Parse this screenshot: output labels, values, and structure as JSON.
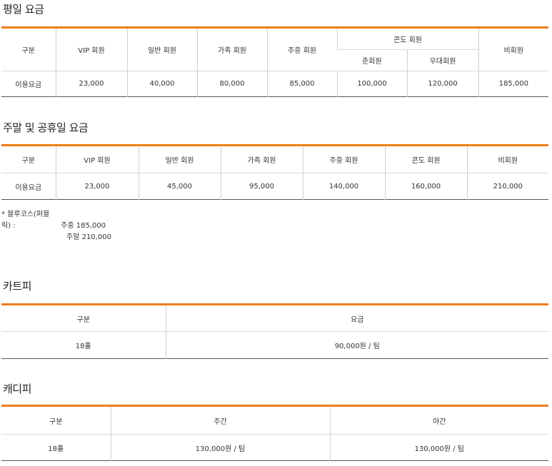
{
  "weekday": {
    "title": "평일 요금",
    "headers": {
      "category": "구분",
      "vip": "VIP 회원",
      "general": "일반 회원",
      "family": "가족 회원",
      "weekday_member": "주중 회원",
      "condo": "콘도 회원",
      "condo_sub1": "준회원",
      "condo_sub2": "우대회원",
      "non_member": "비회원"
    },
    "row": {
      "label": "이용요금",
      "values": [
        "23,000",
        "40,000",
        "80,000",
        "85,000",
        "100,000",
        "120,000",
        "185,000"
      ]
    }
  },
  "weekend": {
    "title": "주말 및 공휴일 요금",
    "headers": [
      "구분",
      "VIP 회원",
      "일반 회원",
      "가족 회원",
      "주중 회원",
      "콘도 회원",
      "비회원"
    ],
    "row": {
      "label": "이용요금",
      "values": [
        "23,000",
        "45,000",
        "95,000",
        "140,000",
        "160,000",
        "210,000"
      ]
    }
  },
  "note": {
    "label": "* 블루코스(퍼블릭) :",
    "line1": "주중 185,000",
    "line2": "주말 210,000"
  },
  "cart": {
    "title": "카트피",
    "headers": [
      "구분",
      "요금"
    ],
    "row": [
      "18홀",
      "90,000원 / 팀"
    ]
  },
  "caddie": {
    "title": "캐디피",
    "headers": [
      "구분",
      "주간",
      "야간"
    ],
    "row": [
      "18홀",
      "130,000원 / 팀",
      "130,000원 / 팀"
    ]
  },
  "colors": {
    "accent": "#f07d1a",
    "border": "#cfcfcf",
    "text": "#333333"
  }
}
